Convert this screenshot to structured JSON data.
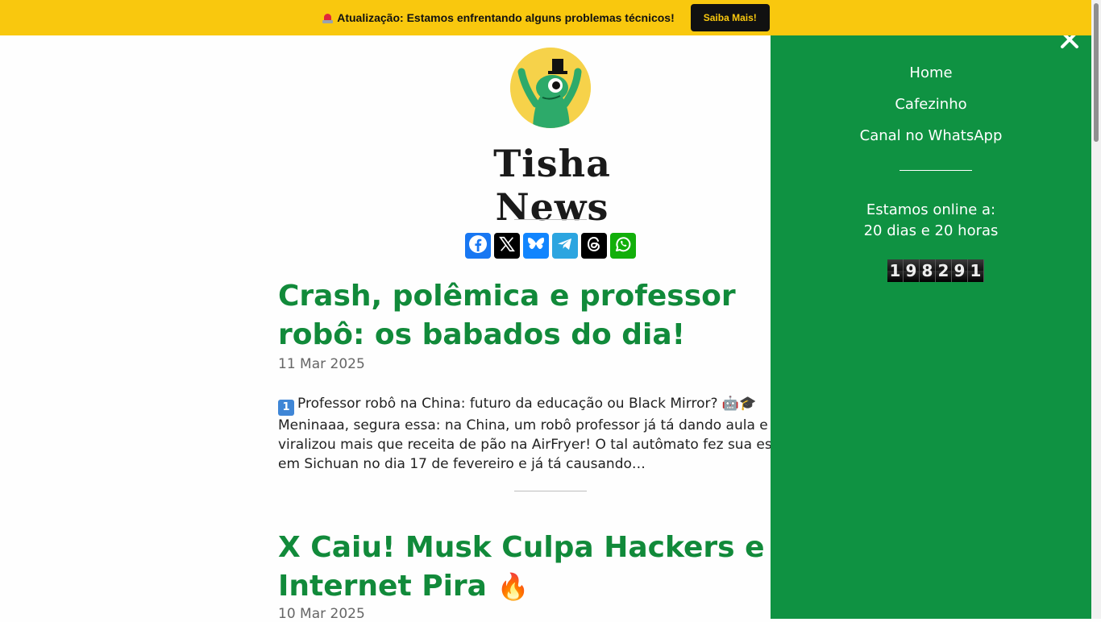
{
  "banner": {
    "text": "Atualização: Estamos enfrentando alguns problemas técnicos!",
    "button_label": "Saiba Mais!",
    "icon": "siren-icon"
  },
  "site": {
    "title": "Tisha News",
    "logo": "frog-with-top-hat-logo"
  },
  "share": {
    "buttons": [
      {
        "name": "facebook-icon",
        "color": "#1877f2"
      },
      {
        "name": "x-icon",
        "color": "#000000"
      },
      {
        "name": "bluesky-icon",
        "color": "#1185fe"
      },
      {
        "name": "telegram-icon",
        "color": "#2ca5e0"
      },
      {
        "name": "threads-icon",
        "color": "#000000"
      },
      {
        "name": "whatsapp-icon",
        "color": "#12af0a"
      }
    ]
  },
  "posts": [
    {
      "title": "Crash, polêmica e professor robô: os babados do dia!",
      "date": "11 Mar 2025",
      "excerpt": "Professor robô na China: futuro da educação ou Black Mirror? 🤖🎓 Meninaaa, segura essa: na China, um robô professor já tá dando aula e viralizou mais que receita de pão na AirFryer! O tal autômato fez sua estreia em Sichuan no dia 17 de fevereiro e já tá causando…",
      "excerpt_badge": "1"
    },
    {
      "title": "X Caiu! Musk Culpa Hackers e Internet Pira",
      "title_emoji": "🔥",
      "date": "10 Mar 2025"
    }
  ],
  "sidemenu": {
    "items": [
      "Home",
      "Cafezinho",
      "Canal no WhatsApp"
    ],
    "online_label": "Estamos online a:",
    "online_value": "20 dias e 20 horas",
    "counter": "198291",
    "close_icon": "close-icon"
  },
  "colors": {
    "banner": "#f9c80e",
    "accent_green": "#118a3a",
    "menu_bg": "#0f9242"
  }
}
